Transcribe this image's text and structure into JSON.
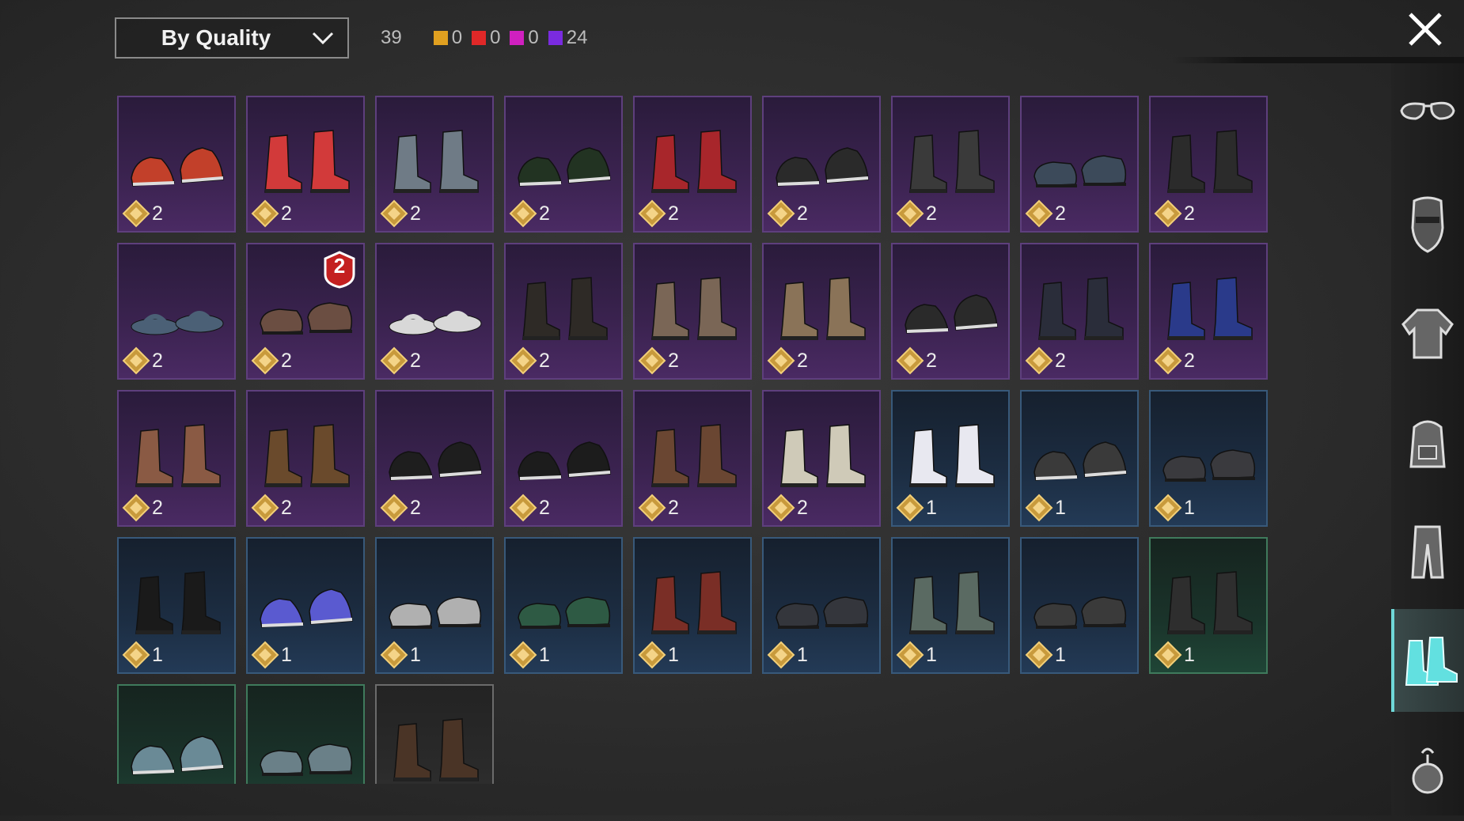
{
  "toolbar": {
    "sort_label": "By Quality",
    "total_count": "39",
    "quality_counts": [
      {
        "color": "#e0a020",
        "count": "0"
      },
      {
        "color": "#e02828",
        "count": "0"
      },
      {
        "color": "#d020c0",
        "count": "0"
      },
      {
        "color": "#7a2be0",
        "count": "24"
      }
    ]
  },
  "items": [
    {
      "rarity": "purple",
      "level": "2",
      "shoe": "#c2402a",
      "style": "sneaker"
    },
    {
      "rarity": "purple",
      "level": "2",
      "shoe": "#d23a3a",
      "style": "boot"
    },
    {
      "rarity": "purple",
      "level": "2",
      "shoe": "#6f7b86",
      "style": "boot"
    },
    {
      "rarity": "purple",
      "level": "2",
      "shoe": "#223322",
      "style": "sneaker"
    },
    {
      "rarity": "purple",
      "level": "2",
      "shoe": "#a8262b",
      "style": "boot"
    },
    {
      "rarity": "purple",
      "level": "2",
      "shoe": "#2a2a2a",
      "style": "sneaker"
    },
    {
      "rarity": "purple",
      "level": "2",
      "shoe": "#3a3a3a",
      "style": "boot"
    },
    {
      "rarity": "purple",
      "level": "2",
      "shoe": "#3c4a5a",
      "style": "loafer"
    },
    {
      "rarity": "purple",
      "level": "2",
      "shoe": "#2b2b2b",
      "style": "boot"
    },
    {
      "rarity": "purple",
      "level": "2",
      "shoe": "#4b6076",
      "style": "sandal"
    },
    {
      "rarity": "purple",
      "level": "2",
      "shoe": "#6b4e42",
      "style": "loafer",
      "badge": "2"
    },
    {
      "rarity": "purple",
      "level": "2",
      "shoe": "#d8d8d8",
      "style": "sandal"
    },
    {
      "rarity": "purple",
      "level": "2",
      "shoe": "#2e2a26",
      "style": "boot"
    },
    {
      "rarity": "purple",
      "level": "2",
      "shoe": "#7a6656",
      "style": "boot"
    },
    {
      "rarity": "purple",
      "level": "2",
      "shoe": "#8a7358",
      "style": "boot"
    },
    {
      "rarity": "purple",
      "level": "2",
      "shoe": "#2a2a2a",
      "style": "sneaker"
    },
    {
      "rarity": "purple",
      "level": "2",
      "shoe": "#2a2d3a",
      "style": "boot"
    },
    {
      "rarity": "purple",
      "level": "2",
      "shoe": "#2a3a8a",
      "style": "boot"
    },
    {
      "rarity": "purple",
      "level": "2",
      "shoe": "#8a5a44",
      "style": "boot"
    },
    {
      "rarity": "purple",
      "level": "2",
      "shoe": "#6a4a2c",
      "style": "boot"
    },
    {
      "rarity": "purple",
      "level": "2",
      "shoe": "#1e1e1e",
      "style": "sneaker"
    },
    {
      "rarity": "purple",
      "level": "2",
      "shoe": "#1c1c1c",
      "style": "sneaker"
    },
    {
      "rarity": "purple",
      "level": "2",
      "shoe": "#6a4632",
      "style": "boot"
    },
    {
      "rarity": "purple",
      "level": "2",
      "shoe": "#cfcab8",
      "style": "boot"
    },
    {
      "rarity": "blue",
      "level": "1",
      "shoe": "#e8e8f0",
      "style": "boot"
    },
    {
      "rarity": "blue",
      "level": "1",
      "shoe": "#3a3a3a",
      "style": "sneaker"
    },
    {
      "rarity": "blue",
      "level": "1",
      "shoe": "#3a3a3e",
      "style": "loafer"
    },
    {
      "rarity": "blue",
      "level": "1",
      "shoe": "#1a1a1a",
      "style": "boot"
    },
    {
      "rarity": "blue",
      "level": "1",
      "shoe": "#5a5ad0",
      "style": "sneaker"
    },
    {
      "rarity": "blue",
      "level": "1",
      "shoe": "#b0b0b0",
      "style": "loafer"
    },
    {
      "rarity": "blue",
      "level": "1",
      "shoe": "#2e5a44",
      "style": "loafer"
    },
    {
      "rarity": "blue",
      "level": "1",
      "shoe": "#7a2e26",
      "style": "boot"
    },
    {
      "rarity": "blue",
      "level": "1",
      "shoe": "#34363c",
      "style": "loafer"
    },
    {
      "rarity": "blue",
      "level": "1",
      "shoe": "#5a6a62",
      "style": "boot"
    },
    {
      "rarity": "blue",
      "level": "1",
      "shoe": "#3a3a3a",
      "style": "loafer"
    },
    {
      "rarity": "green",
      "level": "1",
      "shoe": "#2e2e2e",
      "style": "boot"
    },
    {
      "rarity": "green",
      "level": "",
      "shoe": "#6a8a96",
      "style": "sneaker"
    },
    {
      "rarity": "green",
      "level": "",
      "shoe": "#6a8088",
      "style": "loafer"
    },
    {
      "rarity": "grey",
      "level": "",
      "shoe": "#4a3426",
      "style": "boot"
    }
  ],
  "categories": [
    {
      "name": "glasses",
      "active": false
    },
    {
      "name": "mask",
      "active": false
    },
    {
      "name": "jacket",
      "active": false
    },
    {
      "name": "backpack",
      "active": false
    },
    {
      "name": "pants",
      "active": false
    },
    {
      "name": "shoes",
      "active": true
    },
    {
      "name": "accessory",
      "active": false
    }
  ]
}
